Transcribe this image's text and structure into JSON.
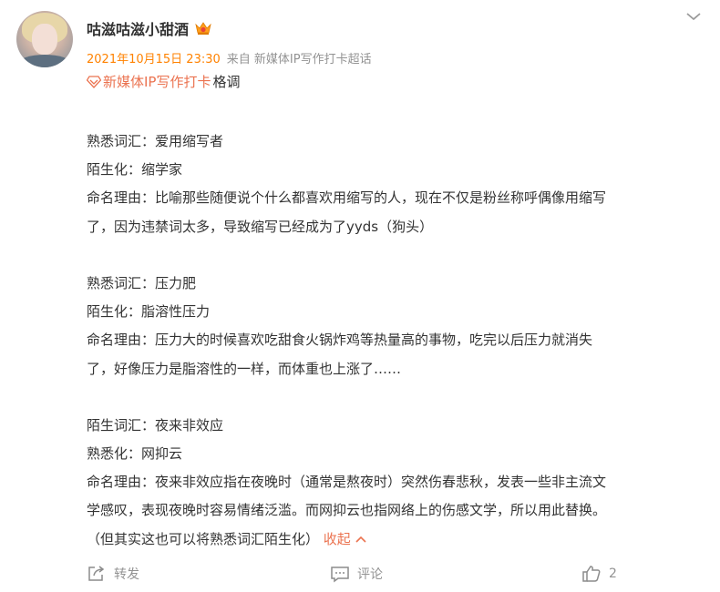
{
  "header": {
    "username": "咕滋咕滋小甜酒",
    "time": "2021年10月15日 23:30",
    "source": "来自 新媒体IP写作打卡超话"
  },
  "topic": {
    "link": "新媒体IP写作打卡",
    "suffix": "格调"
  },
  "body": {
    "lines": [
      "熟悉词汇：爱用缩写者",
      "陌生化：缩学家",
      "命名理由：比喻那些随便说个什么都喜欢用缩写的人，现在不仅是粉丝称呼偶像用缩写",
      "了，因为违禁词太多，导致缩写已经成为了yyds（狗头）",
      "",
      "熟悉词汇：压力肥",
      "陌生化：脂溶性压力",
      "命名理由：压力大的时候喜欢吃甜食火锅炸鸡等热量高的事物，吃完以后压力就消失",
      "了，好像压力是脂溶性的一样，而体重也上涨了……",
      "",
      "陌生词汇：夜来非效应",
      "熟悉化：网抑云",
      "命名理由：夜来非效应指在夜晚时（通常是熬夜时）突然伤春悲秋，发表一些非主流文",
      "学感叹，表现夜晚时容易情绪泛滥。而网抑云也指网络上的伤感文学，所以用此替换。",
      "（但其实这也可以将熟悉词汇陌生化）"
    ],
    "collapse_label": "收起"
  },
  "actions": {
    "forward": "转发",
    "comment": "评论",
    "like_count": "2"
  },
  "colors": {
    "accent": "#eb7350",
    "time": "#ff8200",
    "text": "#333333",
    "muted": "#939393"
  }
}
